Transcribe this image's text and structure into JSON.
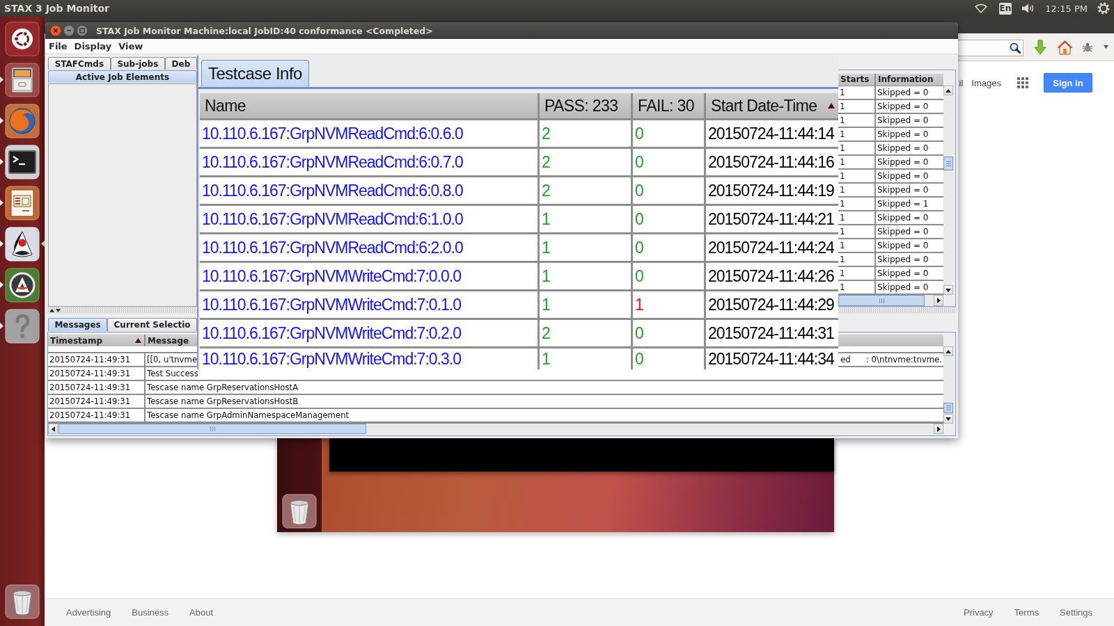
{
  "top_panel": {
    "title": "STAX 3 Job Monitor",
    "keyboard_layout": "En",
    "clock": "12:15 PM"
  },
  "launcher": {
    "items": [
      {
        "kind": "logo",
        "running": false,
        "focused": false
      },
      {
        "kind": "cabinet",
        "running": true,
        "focused": false
      },
      {
        "kind": "globe",
        "running": true,
        "focused": false
      },
      {
        "kind": "terminal",
        "running": true,
        "focused": false
      },
      {
        "kind": "slides",
        "running": true,
        "focused": false
      },
      {
        "kind": "mascot",
        "running": true,
        "focused": true
      },
      {
        "kind": "updater",
        "running": true,
        "focused": false
      },
      {
        "kind": "help",
        "running": true,
        "focused": false
      },
      {
        "kind": "trash",
        "running": false,
        "focused": false
      }
    ]
  },
  "browser": {
    "header_links": [
      "il",
      "Images"
    ],
    "sign_in": "Sign in",
    "footer_left": [
      "Advertising",
      "Business",
      "About"
    ],
    "footer_right": [
      "Privacy",
      "Terms",
      "Settings"
    ]
  },
  "job_monitor": {
    "title": "STAX Job Monitor Machine:local JobID:40 conformance <Completed>",
    "menu": [
      "File",
      "Display",
      "View"
    ],
    "tabs": [
      {
        "label": "STAFCmds",
        "selected": false
      },
      {
        "label": "Sub-jobs",
        "selected": false
      },
      {
        "label": "Deb",
        "selected": false
      },
      {
        "label": "Active Job Elements",
        "selected": true
      }
    ],
    "job_table": {
      "columns": [
        "Starts",
        "Information"
      ],
      "rows": [
        {
          "starts": "1",
          "information": "Skipped = 0"
        },
        {
          "starts": "1",
          "information": "Skipped = 0"
        },
        {
          "starts": "1",
          "information": "Skipped = 0"
        },
        {
          "starts": "1",
          "information": "Skipped = 0"
        },
        {
          "starts": "1",
          "information": "Skipped = 0"
        },
        {
          "starts": "1",
          "information": "Skipped = 0"
        },
        {
          "starts": "1",
          "information": "Skipped = 0"
        },
        {
          "starts": "1",
          "information": "Skipped = 0"
        },
        {
          "starts": "1",
          "information": "Skipped = 1"
        },
        {
          "starts": "1",
          "information": "Skipped = 0"
        },
        {
          "starts": "1",
          "information": "Skipped = 0"
        },
        {
          "starts": "1",
          "information": "Skipped = 0"
        },
        {
          "starts": "1",
          "information": "Skipped = 0"
        },
        {
          "starts": "1",
          "information": "Skipped = 0"
        },
        {
          "starts": "1",
          "information": "Skipped = 0"
        }
      ]
    },
    "message_tabs": [
      {
        "label": "Messages",
        "selected": true
      },
      {
        "label": "Current Selectio",
        "selected": false
      }
    ],
    "messages": {
      "columns": [
        {
          "label": "Timestamp",
          "sorted": true
        },
        {
          "label": "Message",
          "sorted": false
        }
      ],
      "rows": [
        {
          "timestamp": "20150724-11:49:31",
          "message": "[[0, u'tnvme",
          "message_end": "ed      : 0\\ntnvme:tnvme."
        },
        {
          "timestamp": "20150724-11:49:31",
          "message": "Test Success"
        },
        {
          "timestamp": "20150724-11:49:31",
          "message": "Tescase name GrpReservationsHostA"
        },
        {
          "timestamp": "20150724-11:49:31",
          "message": "Tescase name GrpReservationsHostB"
        },
        {
          "timestamp": "20150724-11:49:31",
          "message": "Tescase name GrpAdminNamespaceManagement"
        }
      ]
    }
  },
  "testcase_info": {
    "tabs": [
      {
        "label": "Testcase Info",
        "selected": true
      }
    ],
    "columns": [
      {
        "label": "Name",
        "sorted": false
      },
      {
        "label": "PASS: 233",
        "sorted": false
      },
      {
        "label": "FAIL: 30",
        "sorted": false
      },
      {
        "label": "Start Date-Time",
        "sorted": true
      }
    ],
    "rows": [
      {
        "name": "10.110.6.167:GrpNVMReadCmd:6:0.6.0",
        "pass": "2",
        "fail": "0",
        "failed": false,
        "start": "20150724-11:44:14"
      },
      {
        "name": "10.110.6.167:GrpNVMReadCmd:6:0.7.0",
        "pass": "2",
        "fail": "0",
        "failed": false,
        "start": "20150724-11:44:16"
      },
      {
        "name": "10.110.6.167:GrpNVMReadCmd:6:0.8.0",
        "pass": "2",
        "fail": "0",
        "failed": false,
        "start": "20150724-11:44:19"
      },
      {
        "name": "10.110.6.167:GrpNVMReadCmd:6:1.0.0",
        "pass": "1",
        "fail": "0",
        "failed": false,
        "start": "20150724-11:44:21"
      },
      {
        "name": "10.110.6.167:GrpNVMReadCmd:6:2.0.0",
        "pass": "1",
        "fail": "0",
        "failed": false,
        "start": "20150724-11:44:24"
      },
      {
        "name": "10.110.6.167:GrpNVMWriteCmd:7:0.0.0",
        "pass": "1",
        "fail": "0",
        "failed": false,
        "start": "20150724-11:44:26"
      },
      {
        "name": "10.110.6.167:GrpNVMWriteCmd:7:0.1.0",
        "pass": "1",
        "fail": "1",
        "failed": true,
        "start": "20150724-11:44:29"
      },
      {
        "name": "10.110.6.167:GrpNVMWriteCmd:7:0.2.0",
        "pass": "2",
        "fail": "0",
        "failed": false,
        "start": "20150724-11:44:31"
      },
      {
        "name": "10.110.6.167:GrpNVMWriteCmd:7:0.3.0",
        "pass": "1",
        "fail": "0",
        "failed": false,
        "start": "20150724-11:44:34"
      }
    ]
  }
}
